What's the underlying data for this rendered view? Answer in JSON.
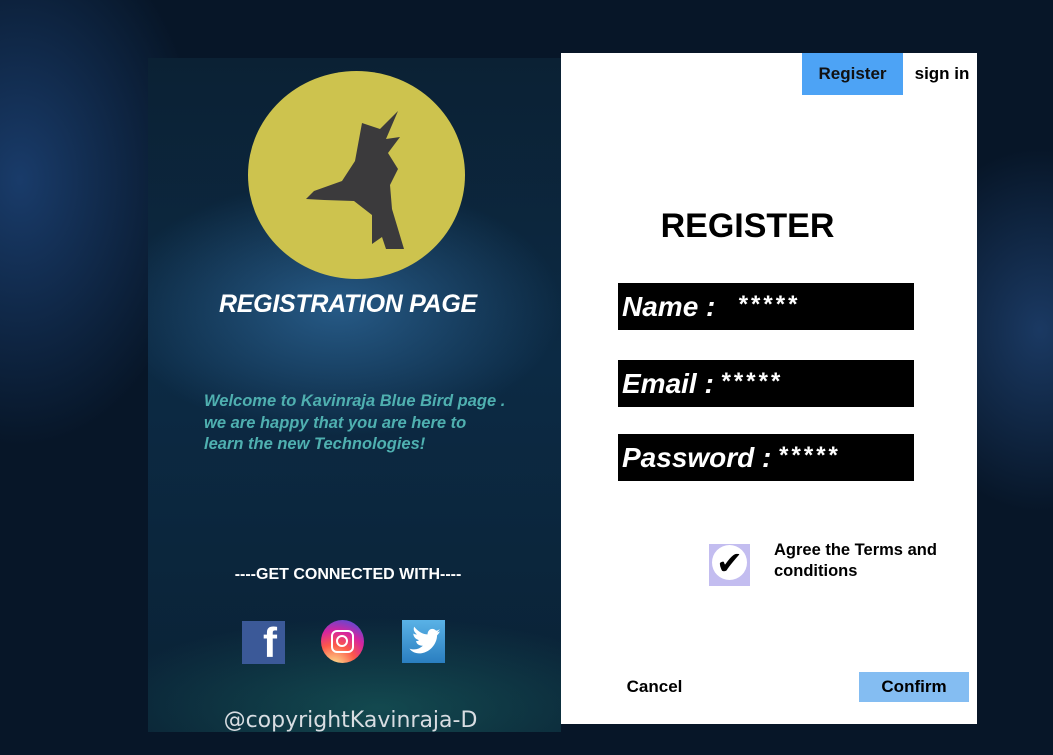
{
  "left": {
    "title": "REGISTRATION PAGE",
    "welcome_lines": [
      "Welcome to  Kavinraja Blue Bird page .",
      "we are happy that you are here to",
      "learn the new Technologies!"
    ],
    "connect": "----GET CONNECTED WITH----",
    "social": [
      "facebook-icon",
      "instagram-icon",
      "twitter-icon"
    ],
    "copyright": "@copyrightKavinraja-D",
    "logo_color": "#cdc34e"
  },
  "tabs": {
    "register": "Register",
    "signin": "sign in"
  },
  "form": {
    "title": "REGISTER",
    "name_label": "Name :",
    "name_value": "*****",
    "email_label": "Email :",
    "email_value": "*****",
    "password_label": "Password :",
    "password_value": "*****",
    "terms_checked": true,
    "terms": "Agree the Terms and conditions",
    "cancel": "Cancel",
    "confirm": "Confirm"
  },
  "colors": {
    "accent": "#4da3f5",
    "confirm": "#84bdf2",
    "welcome_text": "#4fb0b0"
  }
}
